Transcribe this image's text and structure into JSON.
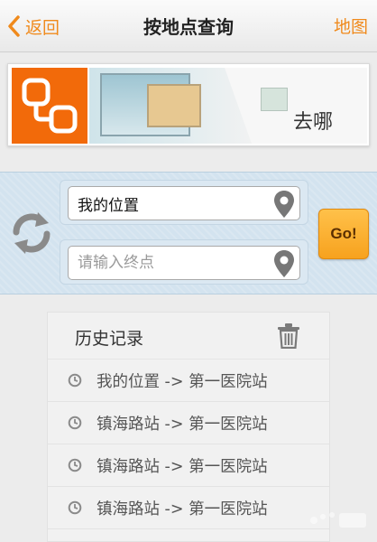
{
  "header": {
    "back_label": "返回",
    "title": "按地点查询",
    "map_label": "地图"
  },
  "banner": {
    "label": "去哪"
  },
  "search": {
    "start_value": "我的位置",
    "end_placeholder": "请输入终点",
    "go_label": "Go!"
  },
  "history": {
    "title": "历史记录",
    "items": [
      "我的位置 -> 第一医院站",
      "镇海路站 -> 第一医院站",
      "镇海路站 -> 第一医院站",
      "镇海路站 -> 第一医院站"
    ]
  },
  "colors": {
    "accent": "#f08a1c",
    "logo": "#f26a0a",
    "search_bg": "#d3e3ef",
    "go_button": "#f7a21e"
  },
  "icons": [
    "chevron-left-icon",
    "route-logo-icon",
    "swap-icon",
    "location-pin-icon",
    "trash-icon",
    "clock-icon"
  ]
}
